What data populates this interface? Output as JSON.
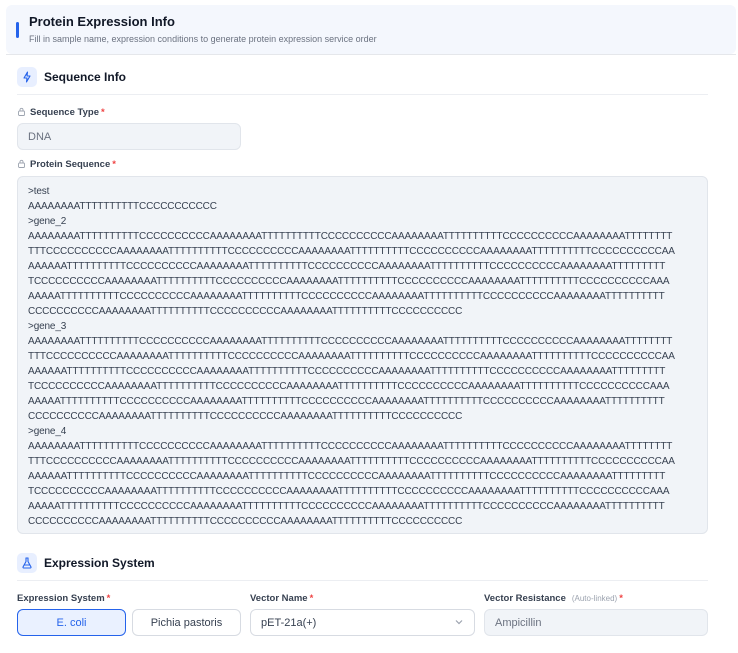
{
  "header": {
    "title": "Protein Expression Info",
    "subtitle": "Fill in sample name, expression conditions to generate protein expression service order"
  },
  "sequence_section": {
    "title": "Sequence Info",
    "icon": "sequence-icon",
    "type_label": "Sequence Type",
    "type_value": "DNA",
    "protein_label": "Protein Sequence",
    "protein_value": ">test\nAAAAAAAATTTTTTTTTTCCCCCCCCCCC\n>gene_2\nAAAAAAAATTTTTTTTTTCCCCCCCCCCAAAAAAAATTTTTTTTTTCCCCCCCCCCAAAAAAAATTTTTTTTTTCCCCCCCCCCAAAAAAAATTTTTTTT\nTTTCCCCCCCCCCAAAAAAAATTTTTTTTTTCCCCCCCCCCAAAAAAAATTTTTTTTTTCCCCCCCCCCAAAAAAAATTTTTTTTTTCCCCCCCCCCAA\nAAAAAATTTTTTTTTTCCCCCCCCCCAAAAAAAATTTTTTTTTTCCCCCCCCCCAAAAAAAATTTTTTTTTTCCCCCCCCCCAAAAAAAATTTTTTTTT\nTCCCCCCCCCCAAAAAAAATTTTTTTTTTCCCCCCCCCCAAAAAAAATTTTTTTTTTCCCCCCCCCCAAAAAAAATTTTTTTTTTCCCCCCCCCCAAA\nAAAAATTTTTTTTTTCCCCCCCCCCAAAAAAAATTTTTTTTTTCCCCCCCCCCAAAAAAAATTTTTTTTTTCCCCCCCCCCAAAAAAAATTTTTTTTTT\nCCCCCCCCCCAAAAAAAATTTTTTTTTTCCCCCCCCCCAAAAAAAATTTTTTTTTTCCCCCCCCCC\n>gene_3\nAAAAAAAATTTTTTTTTTCCCCCCCCCCAAAAAAAATTTTTTTTTTCCCCCCCCCCAAAAAAAATTTTTTTTTTCCCCCCCCCCAAAAAAAATTTTTTTT\nTTTCCCCCCCCCCAAAAAAAATTTTTTTTTTCCCCCCCCCCAAAAAAAATTTTTTTTTTCCCCCCCCCCAAAAAAAATTTTTTTTTTCCCCCCCCCCAA\nAAAAAATTTTTTTTTTCCCCCCCCCCAAAAAAAATTTTTTTTTTCCCCCCCCCCAAAAAAAATTTTTTTTTTCCCCCCCCCCAAAAAAAATTTTTTTTT\nTCCCCCCCCCCAAAAAAAATTTTTTTTTTCCCCCCCCCCAAAAAAAATTTTTTTTTTCCCCCCCCCCAAAAAAAATTTTTTTTTTCCCCCCCCCCAAA\nAAAAATTTTTTTTTTCCCCCCCCCCAAAAAAAATTTTTTTTTTCCCCCCCCCCAAAAAAAATTTTTTTTTTCCCCCCCCCCAAAAAAAATTTTTTTTTT\nCCCCCCCCCCAAAAAAAATTTTTTTTTTCCCCCCCCCCAAAAAAAATTTTTTTTTTCCCCCCCCCC\n>gene_4\nAAAAAAAATTTTTTTTTTCCCCCCCCCCAAAAAAAATTTTTTTTTTCCCCCCCCCCAAAAAAAATTTTTTTTTTCCCCCCCCCCAAAAAAAATTTTTTTT\nTTTCCCCCCCCCCAAAAAAAATTTTTTTTTTCCCCCCCCCCAAAAAAAATTTTTTTTTTCCCCCCCCCCAAAAAAAATTTTTTTTTTCCCCCCCCCCAA\nAAAAAATTTTTTTTTTCCCCCCCCCCAAAAAAAATTTTTTTTTTCCCCCCCCCCAAAAAAAATTTTTTTTTTCCCCCCCCCCAAAAAAAATTTTTTTTT\nTCCCCCCCCCCAAAAAAAATTTTTTTTTTCCCCCCCCCCAAAAAAAATTTTTTTTTTCCCCCCCCCCAAAAAAAATTTTTTTTTTCCCCCCCCCCAAA\nAAAAATTTTTTTTTTCCCCCCCCCCAAAAAAAATTTTTTTTTTCCCCCCCCCCAAAAAAAATTTTTTTTTTCCCCCCCCCCAAAAAAAATTTTTTTTTT\nCCCCCCCCCCAAAAAAAATTTTTTTTTTCCCCCCCCCCAAAAAAAATTTTTTTTTTCCCCCCCCCC"
  },
  "expression_section": {
    "title": "Expression System",
    "icon": "flask-icon",
    "system_label": "Expression System",
    "system_options": [
      "E. coli",
      "Pichia pastoris"
    ],
    "system_selected": "E. coli",
    "vector_label": "Vector Name",
    "vector_value": "pET-21a(+)",
    "resistance_label": "Vector Resistance",
    "resistance_hint": "(Auto-linked)",
    "resistance_value": "Ampicillin"
  },
  "colors": {
    "accent": "#2563eb",
    "required": "#ef4444",
    "header_bg": "#f4f7fd",
    "field_bg": "#f1f4f8"
  }
}
